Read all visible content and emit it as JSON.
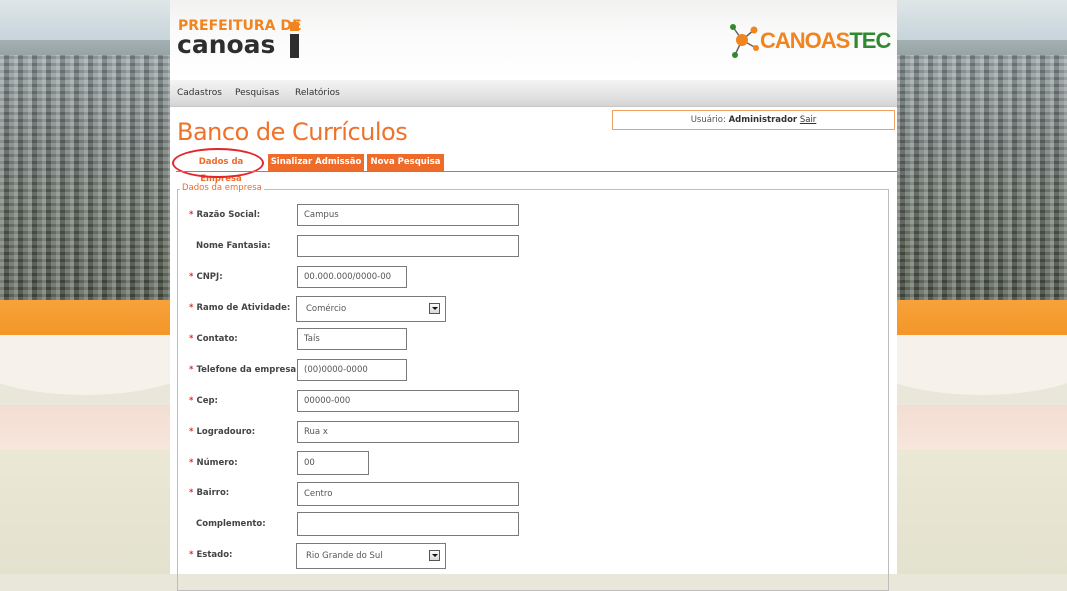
{
  "branding": {
    "prefeitura_line1": "PREFEITURA DE",
    "prefeitura_line2": "canoas",
    "canoastec_a": "CANOAS",
    "canoastec_b": "TEC"
  },
  "menu": {
    "items": [
      {
        "label": "Cadastros"
      },
      {
        "label": "Pesquisas"
      },
      {
        "label": "Relatórios"
      }
    ]
  },
  "user": {
    "prefix": "Usuário:",
    "name": "Administrador",
    "logout": "Sair"
  },
  "page_title": "Banco de Currículos",
  "tabs": [
    {
      "label": "Dados da Empresa",
      "active": true
    },
    {
      "label": "Sinalizar Admissão",
      "active": false
    },
    {
      "label": "Nova Pesquisa",
      "active": false
    }
  ],
  "form": {
    "legend": "Dados da empresa",
    "fields": [
      {
        "label": "Razão Social:",
        "required": true,
        "value": "Campus"
      },
      {
        "label": "Nome Fantasia:",
        "required": false,
        "value": ""
      },
      {
        "label": "CNPJ:",
        "required": true,
        "value": "00.000.000/0000-00"
      },
      {
        "label": "Ramo de Atividade:",
        "required": true,
        "value": "Comércio",
        "type": "select"
      },
      {
        "label": "Contato:",
        "required": true,
        "value": "Taís"
      },
      {
        "label": "Telefone da empresa:",
        "required": true,
        "value": "(00)0000-0000"
      },
      {
        "label": "Cep:",
        "required": true,
        "value": "00000-000"
      },
      {
        "label": "Logradouro:",
        "required": true,
        "value": "Rua x"
      },
      {
        "label": "Número:",
        "required": true,
        "value": "00"
      },
      {
        "label": "Bairro:",
        "required": true,
        "value": "Centro"
      },
      {
        "label": "Complemento:",
        "required": false,
        "value": ""
      },
      {
        "label": "Estado:",
        "required": true,
        "value": "Rio Grande do Sul",
        "type": "select"
      }
    ]
  },
  "colors": {
    "accent_orange": "#ef6b2a",
    "required_star": "#e0322b",
    "tec_green": "#2f8a2f",
    "highlight_ring": "#e3262b"
  }
}
